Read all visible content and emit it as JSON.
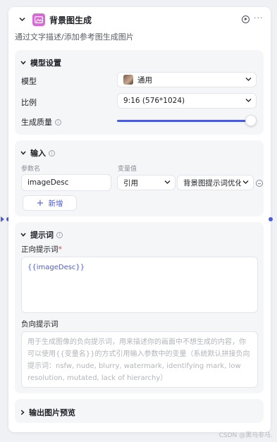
{
  "node": {
    "title": "背景图生成",
    "description": "通过文字描述/添加参考图生成图片"
  },
  "model_settings": {
    "title": "模型设置",
    "model_label": "模型",
    "model_value": "通用",
    "ratio_label": "比例",
    "ratio_value": "9:16 (576*1024)",
    "quality_label": "生成质量",
    "quality_level": 1.0
  },
  "input_section": {
    "title": "输入",
    "col_param": "参数名",
    "col_value": "变量值",
    "param_name": "imageDesc",
    "ref_type": "引用",
    "ref_value": "背景图提示词优化",
    "add_label": "新增"
  },
  "prompt_section": {
    "title": "提示词",
    "positive_label": "正向提示词",
    "required_mark": "*",
    "positive_value": "{{imageDesc}}",
    "negative_label": "负向提示词",
    "negative_placeholder": "用于生成图像的负向提示词，用来描述你的画面中不想生成的内容，你可以使用{{变量名}}的方式引用输入参数中的变量（系统默认拼接负向提示词：nsfw, nude, blurry, watermark, identifying mark, low resolution, mutated, lack of hierarchy）"
  },
  "output_section": {
    "title": "输出图片预览"
  },
  "watermark": "CSDN @黑马非马."
}
